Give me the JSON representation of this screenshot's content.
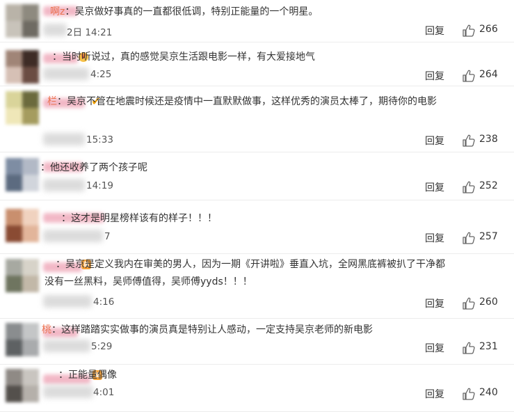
{
  "comments": [
    {
      "name_visible": "啊z",
      "text": "吴京做好事真的一直都很低调，特别正能量的一个明星。",
      "time": "2日 14:21",
      "reply": "回复",
      "likes": "266",
      "badge": "none",
      "avatar_colors": [
        "#b9b3a8",
        "#8e8a7f",
        "#c8c3ba",
        "#6f6b63"
      ]
    },
    {
      "name_visible": "",
      "text": "当时听说过，真的感觉吴京生活跟电影一样，有大爱接地气",
      "time": "4:25",
      "reply": "回复",
      "likes": "264",
      "badge": "crown",
      "avatar_colors": [
        "#a08577",
        "#3e2c26",
        "#d6c0b5",
        "#6b4d43"
      ]
    },
    {
      "name_visible": "栏",
      "text": "吴京不管在地震时候还是疫情中一直默默做事，这样优秀的演员太棒了，期待你的电影",
      "time": "15:33",
      "reply": "回复",
      "likes": "238",
      "badge": "v",
      "avatar_colors": [
        "#d9d49a",
        "#6b6a3d",
        "#efe7b8",
        "#a59c5f"
      ]
    },
    {
      "name_visible": "",
      "text": "他还收养了两个孩子呢",
      "time": "14:19",
      "reply": "回复",
      "likes": "252",
      "badge": "none",
      "avatar_colors": [
        "#7e8da3",
        "#b2b9c6",
        "#5c6b80",
        "#d1d5dc"
      ]
    },
    {
      "name_visible": "",
      "text": "这才是明星榜样该有的样子！！！",
      "time": "7",
      "reply": "回复",
      "likes": "257",
      "badge": "none",
      "avatar_colors": [
        "#c98f6e",
        "#f0d2bf",
        "#8a4b33",
        "#e2b59a"
      ]
    },
    {
      "name_visible": "",
      "text": "吴京是定义我内在审美的男人，因为一期《开讲啦》垂直入坑，全网黑底裤被扒了干净都没有一丝黑料，吴师傅值得，吴师傅yyds！！！",
      "time": "4:16",
      "reply": "回复",
      "likes": "260",
      "badge": "fan",
      "avatar_colors": [
        "#a7a9a1",
        "#d7d3c9",
        "#6f7560",
        "#c2b8a8"
      ]
    },
    {
      "name_visible": "桃",
      "text": "这样踏踏实实做事的演员真是特别让人感动，一定支持吴京老师的新电影",
      "time": "5:29",
      "reply": "回复",
      "likes": "231",
      "badge": "none",
      "avatar_colors": [
        "#8a8d8f",
        "#c4c6c7",
        "#5e6163",
        "#a9abad"
      ]
    },
    {
      "name_visible": "",
      "text": "正能量偶像",
      "time": "4:01",
      "reply": "回复",
      "likes": "240",
      "badge": "fan",
      "avatar_colors": [
        "#8f8a85",
        "#c9c5c0",
        "#54504c",
        "#b5b0aa"
      ]
    }
  ],
  "colors": {
    "name": "#eb7350",
    "text": "#333333",
    "divider": "#ececec"
  },
  "icons": {
    "like": "thumbs-up-icon",
    "vip": "crown-icon",
    "verified": "v-badge-icon",
    "fan": "fan-badge-icon"
  }
}
